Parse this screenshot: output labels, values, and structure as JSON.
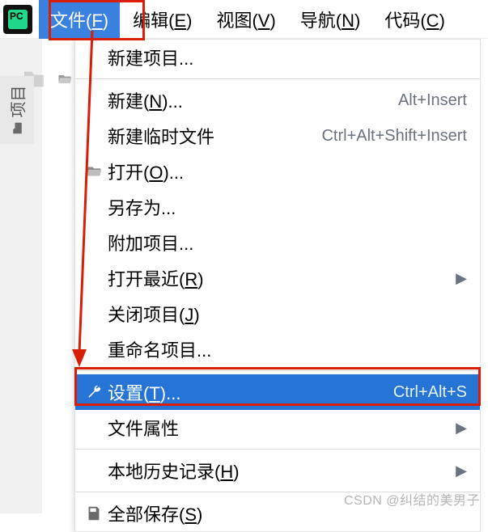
{
  "app": {
    "logoText": "PC"
  },
  "menubar": {
    "file": {
      "text": "文件(",
      "mn": "F",
      "suffix": ")"
    },
    "edit": {
      "text": "编辑(",
      "mn": "E",
      "suffix": ")"
    },
    "view": {
      "text": "视图(",
      "mn": "V",
      "suffix": ")"
    },
    "nav": {
      "text": "导航(",
      "mn": "N",
      "suffix": ")"
    },
    "code": {
      "text": "代码(",
      "mn": "C",
      "suffix": ")"
    }
  },
  "sidebar": {
    "projectTab": "项目"
  },
  "dropdown": {
    "newProject": {
      "label": "新建项目...",
      "mn": ""
    },
    "new": {
      "label": "新建(",
      "mn": "N",
      "suffix": ")...",
      "shortcut": "Alt+Insert"
    },
    "newScratch": {
      "label": "新建临时文件",
      "shortcut": "Ctrl+Alt+Shift+Insert"
    },
    "open": {
      "label": "打开(",
      "mn": "O",
      "suffix": ")..."
    },
    "saveAs": {
      "label": "另存为..."
    },
    "attachProject": {
      "label": "附加项目..."
    },
    "openRecent": {
      "label": "打开最近(",
      "mn": "R",
      "suffix": ")"
    },
    "closeProject": {
      "label": "关闭项目(",
      "mn": "J",
      "suffix": ")"
    },
    "renameProject": {
      "label": "重命名项目..."
    },
    "settings": {
      "label": "设置(",
      "mn": "T",
      "suffix": ")...",
      "shortcut": "Ctrl+Alt+S"
    },
    "fileProps": {
      "label": "文件属性"
    },
    "localHistory": {
      "label": "本地历史记录(",
      "mn": "H",
      "suffix": ")"
    },
    "saveAll": {
      "label": "全部保存(",
      "mn": "S",
      "suffix": ")"
    }
  },
  "watermark": "CSDN @纠结的美男子"
}
